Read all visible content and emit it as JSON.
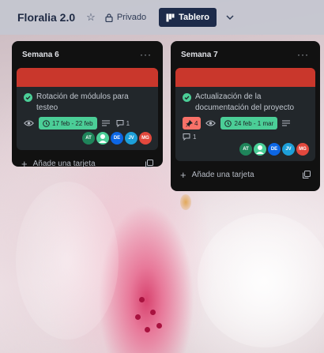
{
  "header": {
    "board_title": "Floralia 2.0",
    "star_icon": "star-icon",
    "privacy_label": "Privado",
    "view_label": "Tablero",
    "colors": {
      "bar": "#c4c7d0",
      "view_button": "#1d2b4a"
    }
  },
  "lists": [
    {
      "title": "Semana 6",
      "card": {
        "title": "Rotación de módulos para testeo",
        "date": "17 feb - 22 feb",
        "comments": "1",
        "members": [
          {
            "initials": "AT",
            "color": "#1f845a"
          },
          {
            "initials": "",
            "color": "#4bce97",
            "icon": "person-icon"
          },
          {
            "initials": "DE",
            "color": "#0c66e4"
          },
          {
            "initials": "JV",
            "color": "#1d9fd8"
          },
          {
            "initials": "MG",
            "color": "#e2483d"
          }
        ]
      },
      "add_label": "Añade una tarjeta"
    },
    {
      "title": "Semana 7",
      "card": {
        "title": "Actualización de la documentación del proyecto",
        "attachments": "4",
        "date": "24 feb - 1 mar",
        "comments": "1",
        "members": [
          {
            "initials": "AT",
            "color": "#1f845a"
          },
          {
            "initials": "",
            "color": "#4bce97",
            "icon": "person-icon"
          },
          {
            "initials": "DE",
            "color": "#0c66e4"
          },
          {
            "initials": "JV",
            "color": "#1d9fd8"
          },
          {
            "initials": "MG",
            "color": "#e2483d"
          }
        ]
      },
      "add_label": "Añade una tarjeta"
    }
  ],
  "colors": {
    "list_bg": "#111111",
    "card_bg": "#22272b",
    "cover": "#c9372c",
    "date_badge": "#4bce97",
    "attach_badge": "#f87168"
  }
}
